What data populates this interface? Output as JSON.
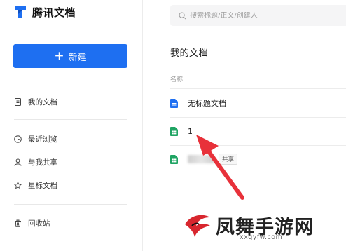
{
  "app": {
    "name": "腾讯文档"
  },
  "sidebar": {
    "new_button": "新建",
    "items": [
      {
        "label": "我的文档",
        "icon": "document-icon"
      },
      {
        "label": "最近浏览",
        "icon": "clock-icon"
      },
      {
        "label": "与我共享",
        "icon": "user-icon"
      },
      {
        "label": "星标文档",
        "icon": "star-icon"
      },
      {
        "label": "回收站",
        "icon": "trash-icon"
      }
    ]
  },
  "search": {
    "placeholder": "搜索标题/正文/创建人"
  },
  "main": {
    "title": "我的文档",
    "column_header": "名称",
    "files": [
      {
        "name": "无标题文档",
        "type": "doc",
        "color": "#1e6ff1"
      },
      {
        "name": "1",
        "type": "sheet",
        "color": "#1fa463"
      },
      {
        "name": "",
        "type": "sheet",
        "color": "#1fa463",
        "badge": "共享"
      }
    ]
  },
  "colors": {
    "accent": "#1e6ff1",
    "sheet": "#1fa463",
    "annotation_arrow": "#e8313a"
  },
  "watermark": {
    "text": "凤舞手游网",
    "url": "xxqyfw.com"
  }
}
